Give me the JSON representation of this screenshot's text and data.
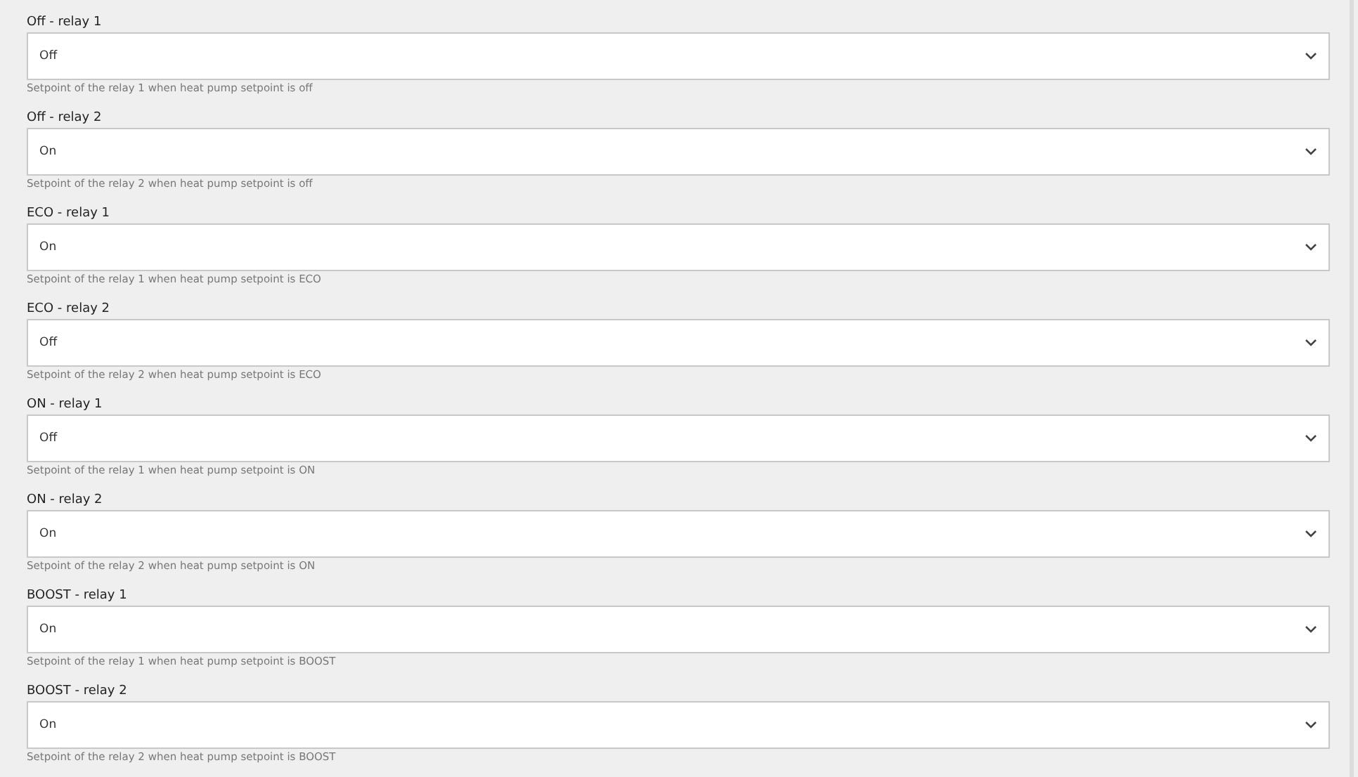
{
  "fields": [
    {
      "label": "Off - relay 1",
      "value": "Off",
      "hint": "Setpoint of the relay 1 when heat pump setpoint is off"
    },
    {
      "label": "Off - relay 2",
      "value": "On",
      "hint": "Setpoint of the relay 2 when heat pump setpoint is off"
    },
    {
      "label": "ECO - relay 1",
      "value": "On",
      "hint": "Setpoint of the relay 1 when heat pump setpoint is ECO"
    },
    {
      "label": "ECO - relay 2",
      "value": "Off",
      "hint": "Setpoint of the relay 2 when heat pump setpoint is ECO"
    },
    {
      "label": "ON - relay 1",
      "value": "Off",
      "hint": "Setpoint of the relay 1 when heat pump setpoint is ON"
    },
    {
      "label": "ON - relay 2",
      "value": "On",
      "hint": "Setpoint of the relay 2 when heat pump setpoint is ON"
    },
    {
      "label": "BOOST - relay 1",
      "value": "On",
      "hint": "Setpoint of the relay 1 when heat pump setpoint is BOOST"
    },
    {
      "label": "BOOST - relay 2",
      "value": "On",
      "hint": "Setpoint of the relay 2 when heat pump setpoint is BOOST"
    }
  ]
}
